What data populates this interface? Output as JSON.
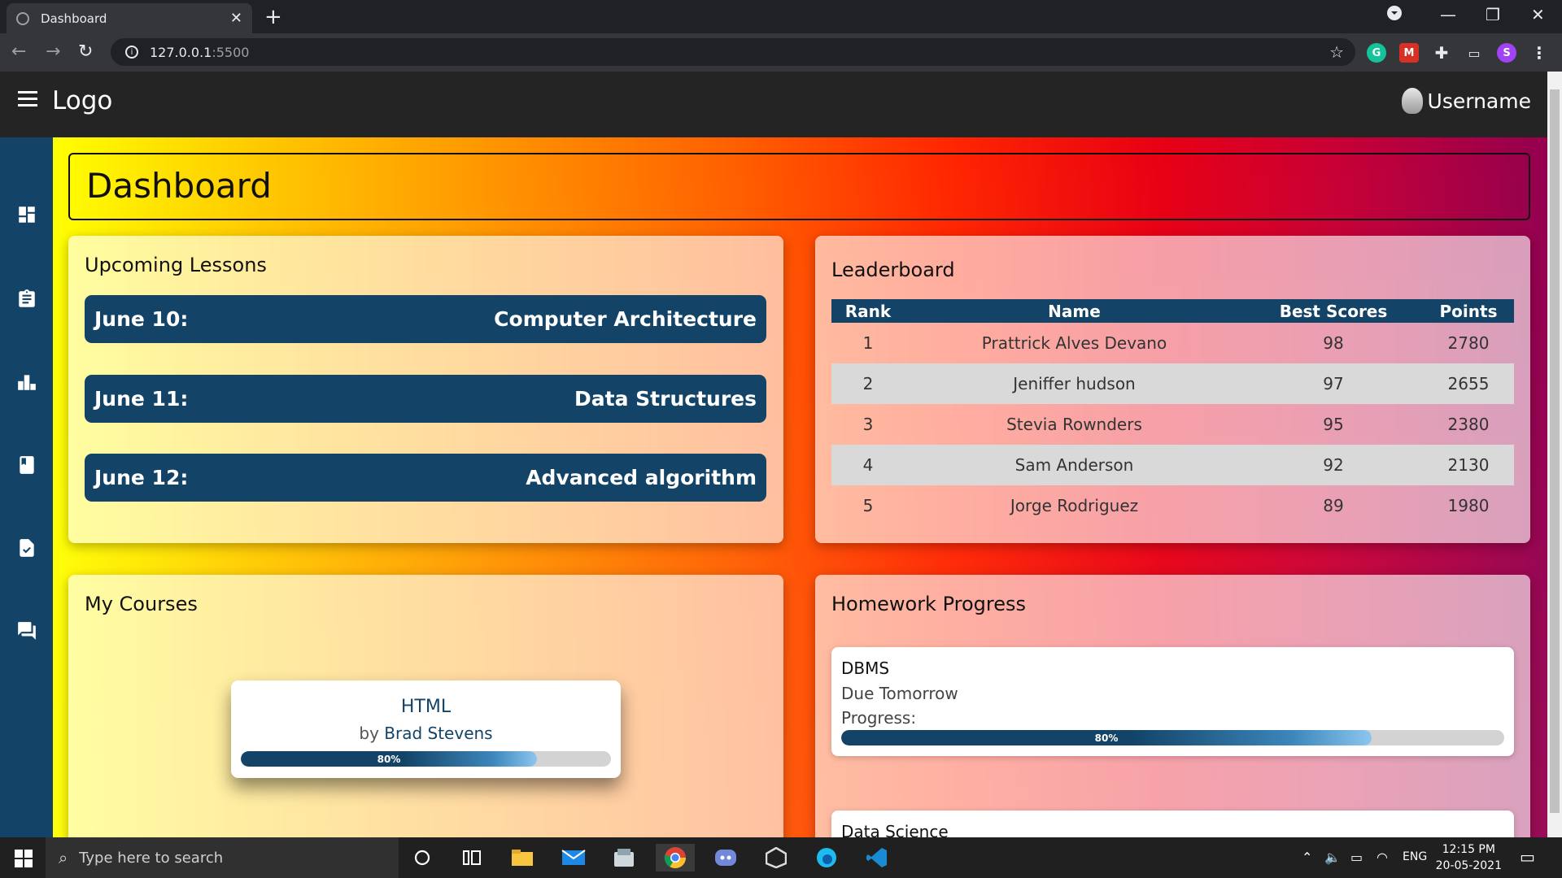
{
  "browser": {
    "tab_title": "Dashboard",
    "url_host": "127.0.0.1",
    "url_port": ":5500"
  },
  "topbar": {
    "logo": "Logo",
    "username": "Username"
  },
  "sidebar": {
    "icons": [
      "dashboard-icon",
      "assignment-icon",
      "leaderboard-icon",
      "book-icon",
      "task-icon",
      "chat-icon"
    ]
  },
  "page": {
    "title": "Dashboard"
  },
  "lessons": {
    "heading": "Upcoming Lessons",
    "items": [
      {
        "date": "June 10:",
        "subject": "Computer Architecture"
      },
      {
        "date": "June 11:",
        "subject": "Data Structures"
      },
      {
        "date": "June 12:",
        "subject": "Advanced algorithm"
      }
    ]
  },
  "leaderboard": {
    "heading": "Leaderboard",
    "columns": [
      "Rank",
      "Name",
      "Best Scores",
      "Points"
    ],
    "rows": [
      [
        "1",
        "Prattrick Alves Devano",
        "98",
        "2780"
      ],
      [
        "2",
        "Jeniffer hudson",
        "97",
        "2655"
      ],
      [
        "3",
        "Stevia Rownders",
        "95",
        "2380"
      ],
      [
        "4",
        "Sam Anderson",
        "92",
        "2130"
      ],
      [
        "5",
        "Jorge Rodriguez",
        "89",
        "1980"
      ]
    ]
  },
  "courses": {
    "heading": "My Courses",
    "items": [
      {
        "name": "HTML",
        "by": "by",
        "author": "Brad Stevens",
        "progress": 0.8,
        "progress_label": "80%"
      }
    ]
  },
  "homework": {
    "heading": "Homework Progress",
    "items": [
      {
        "name": "DBMS",
        "due": "Due Tomorrow",
        "progress_text": "Progress:",
        "progress": 0.8,
        "progress_label": "80%"
      },
      {
        "name": "Data Science"
      }
    ]
  },
  "taskbar": {
    "search_placeholder": "Type here to search",
    "language": "ENG",
    "time": "12:15 PM",
    "date": "20-05-2021"
  },
  "colors": {
    "primary": "#134468",
    "topbar": "#242424"
  }
}
